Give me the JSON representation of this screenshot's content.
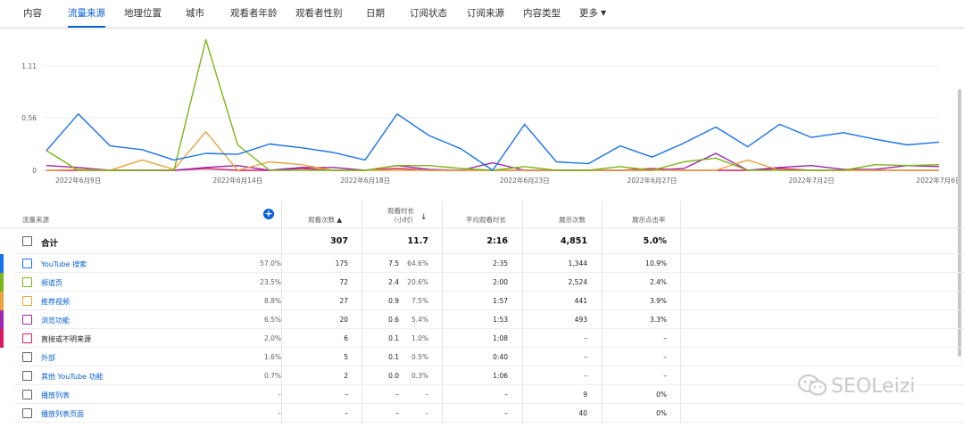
{
  "tabs": [
    {
      "label": "内容",
      "active": false
    },
    {
      "label": "流量来源",
      "active": true
    },
    {
      "label": "地理位置",
      "active": false
    },
    {
      "label": "城市",
      "active": false
    },
    {
      "label": "观看者年龄",
      "active": false
    },
    {
      "label": "观看者性别",
      "active": false
    },
    {
      "label": "日期",
      "active": false
    },
    {
      "label": "订阅状态",
      "active": false
    },
    {
      "label": "订阅来源",
      "active": false
    },
    {
      "label": "内容类型",
      "active": false
    },
    {
      "label": "更多",
      "active": false
    }
  ],
  "chart_data": {
    "type": "line",
    "x": [
      "2022-06-08",
      "2022-06-09",
      "2022-06-10",
      "2022-06-11",
      "2022-06-12",
      "2022-06-13",
      "2022-06-14",
      "2022-06-15",
      "2022-06-16",
      "2022-06-17",
      "2022-06-18",
      "2022-06-19",
      "2022-06-20",
      "2022-06-21",
      "2022-06-22",
      "2022-06-23",
      "2022-06-24",
      "2022-06-25",
      "2022-06-26",
      "2022-06-27",
      "2022-06-28",
      "2022-06-29",
      "2022-06-30",
      "2022-07-01",
      "2022-07-02",
      "2022-07-03",
      "2022-07-04",
      "2022-07-05",
      "2022-07-06"
    ],
    "tick_labels": [
      "2022年6月9日",
      "2022年6月14日",
      "2022年6月18日",
      "2022年6月23日",
      "2022年6月27日",
      "2022年7月2日",
      "2022年7月6日"
    ],
    "tick_dates": [
      "2022-06-09",
      "2022-06-14",
      "2022-06-18",
      "2022-06-23",
      "2022-06-27",
      "2022-07-02",
      "2022-07-06"
    ],
    "y_ticks": [
      "0",
      "0.56",
      "1.11"
    ],
    "ylim": [
      0,
      1.11
    ],
    "grid": true,
    "series": [
      {
        "color": "#1a73e8",
        "values": [
          0.21,
          0.6,
          0.26,
          0.22,
          0.11,
          0.18,
          0.17,
          0.28,
          0.24,
          0.19,
          0.11,
          0.6,
          0.37,
          0.23,
          0.0,
          0.49,
          0.09,
          0.07,
          0.26,
          0.14,
          0.29,
          0.46,
          0.25,
          0.49,
          0.35,
          0.4,
          0.33,
          0.27,
          0.3
        ]
      },
      {
        "color": "#7cb518",
        "values": [
          0.21,
          0.0,
          0.0,
          0.0,
          0.0,
          1.39,
          0.27,
          0.0,
          0.0,
          0.0,
          0.0,
          0.05,
          0.05,
          0.02,
          0.0,
          0.04,
          0.0,
          0.0,
          0.04,
          0.0,
          0.09,
          0.13,
          0.0,
          0.0,
          0.0,
          0.0,
          0.06,
          0.05,
          0.06
        ]
      },
      {
        "color": "#e8a33d",
        "values": [
          0.0,
          0.01,
          0.0,
          0.11,
          0.01,
          0.41,
          0.0,
          0.09,
          0.06,
          0.0,
          0.0,
          0.0,
          0.0,
          0.0,
          0.0,
          0.0,
          0.0,
          0.0,
          0.0,
          0.0,
          0.0,
          0.0,
          0.11,
          0.0,
          0.0,
          0.0,
          0.0,
          0.0,
          0.0
        ]
      },
      {
        "color": "#9c27b0",
        "values": [
          0.05,
          0.03,
          0.0,
          0.0,
          0.0,
          0.03,
          0.05,
          0.0,
          0.03,
          0.03,
          0.0,
          0.05,
          0.01,
          0.0,
          0.08,
          0.0,
          0.0,
          0.0,
          0.0,
          0.0,
          0.02,
          0.18,
          0.0,
          0.03,
          0.05,
          0.01,
          0.01,
          0.05,
          0.04
        ]
      },
      {
        "color": "#d81b60",
        "values": [
          0.0,
          0.0,
          0.0,
          0.0,
          0.0,
          0.02,
          0.0,
          0.0,
          0.02,
          0.0,
          0.0,
          0.02,
          0.0,
          0.0,
          0.0,
          0.0,
          0.0,
          0.0,
          0.0,
          0.02,
          0.0,
          0.0,
          0.0,
          0.02,
          0.0,
          0.0,
          0.0,
          0.0,
          0.0
        ]
      }
    ]
  },
  "table": {
    "headers": {
      "source": "流量来源",
      "views": "观看次数",
      "watch_time": "观看时长",
      "watch_time_unit": "（小时）",
      "avg_duration": "平均观看时长",
      "impressions": "展示次数",
      "ctr": "展示点击率"
    },
    "total": {
      "label": "合计",
      "views": "307",
      "watch_time": "11.7",
      "avg_duration": "2:16",
      "impressions": "4,851",
      "ctr": "5.0%"
    },
    "rows": [
      {
        "label": "YouTube 搜索",
        "color": "#1a73e8",
        "link": true,
        "views": "175",
        "views_pct": "57.0%",
        "watch": "7.5",
        "watch_pct": "64.6%",
        "avg": "2:35",
        "impr": "1,344",
        "ctr": "10.9%"
      },
      {
        "label": "频道页",
        "color": "#7cb518",
        "link": true,
        "views": "72",
        "views_pct": "23.5%",
        "watch": "2.4",
        "watch_pct": "20.6%",
        "avg": "2:00",
        "impr": "2,524",
        "ctr": "2.4%"
      },
      {
        "label": "推荐视频",
        "color": "#e8a33d",
        "link": true,
        "views": "27",
        "views_pct": "8.8%",
        "watch": "0.9",
        "watch_pct": "7.5%",
        "avg": "1:57",
        "impr": "441",
        "ctr": "3.9%"
      },
      {
        "label": "浏览功能",
        "color": "#9c27b0",
        "link": true,
        "views": "20",
        "views_pct": "6.5%",
        "watch": "0.6",
        "watch_pct": "5.4%",
        "avg": "1:53",
        "impr": "493",
        "ctr": "3.3%"
      },
      {
        "label": "直接或不明来源",
        "color": "#d81b60",
        "link": false,
        "views": "6",
        "views_pct": "2.0%",
        "watch": "0.1",
        "watch_pct": "1.0%",
        "avg": "1:08",
        "impr": "–",
        "ctr": "–"
      },
      {
        "label": "外部",
        "color": "",
        "link": true,
        "views": "5",
        "views_pct": "1.6%",
        "watch": "0.1",
        "watch_pct": "0.5%",
        "avg": "0:40",
        "impr": "–",
        "ctr": "–"
      },
      {
        "label": "其他 YouTube 功能",
        "color": "",
        "link": true,
        "views": "2",
        "views_pct": "0.7%",
        "watch": "0.0",
        "watch_pct": "0.3%",
        "avg": "1:06",
        "impr": "–",
        "ctr": "–"
      },
      {
        "label": "播放列表",
        "color": "",
        "link": true,
        "views": "–",
        "views_pct": "–",
        "watch": "–",
        "watch_pct": "–",
        "avg": "–",
        "impr": "9",
        "ctr": "0%"
      },
      {
        "label": "播放列表页面",
        "color": "",
        "link": true,
        "views": "–",
        "views_pct": "–",
        "watch": "–",
        "watch_pct": "–",
        "avg": "–",
        "impr": "40",
        "ctr": "0%"
      }
    ]
  },
  "watermark": {
    "text": "SEOLeizi",
    "icon": "wechat-icon"
  },
  "colors": {
    "accent": "#065fd4",
    "link": "#065fd4"
  }
}
